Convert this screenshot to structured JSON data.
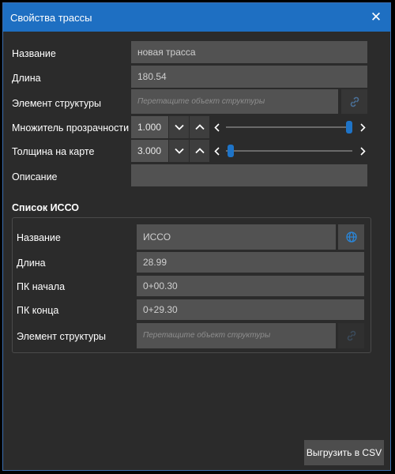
{
  "window": {
    "title": "Свойства трассы"
  },
  "form": {
    "name": {
      "label": "Название",
      "value": "новая трасса"
    },
    "length": {
      "label": "Длина",
      "value": "180.54"
    },
    "structure": {
      "label": "Элемент структуры",
      "placeholder": "Перетащите объект структуры"
    },
    "opacity": {
      "label": "Множитель прозрачности",
      "value": "1.000",
      "slider_fraction": 1.0
    },
    "thickness": {
      "label": "Толщина на карте",
      "value": "3.000",
      "slider_fraction": 0.0
    },
    "description": {
      "label": "Описание",
      "value": ""
    }
  },
  "isso": {
    "section_title": "Список ИССО",
    "name": {
      "label": "Название",
      "value": "ИССО"
    },
    "length": {
      "label": "Длина",
      "value": "28.99"
    },
    "pk_start": {
      "label": "ПК начала",
      "value": "0+00.30"
    },
    "pk_end": {
      "label": "ПК конца",
      "value": "0+29.30"
    },
    "structure": {
      "label": "Элемент структуры",
      "placeholder": "Перетащите объект структуры"
    }
  },
  "footer": {
    "export_label": "Выгрузить в CSV"
  },
  "colors": {
    "titlebar": "#1e6fc2",
    "background": "#2b2b2b",
    "field": "#525252",
    "accent": "#1e74c8"
  }
}
